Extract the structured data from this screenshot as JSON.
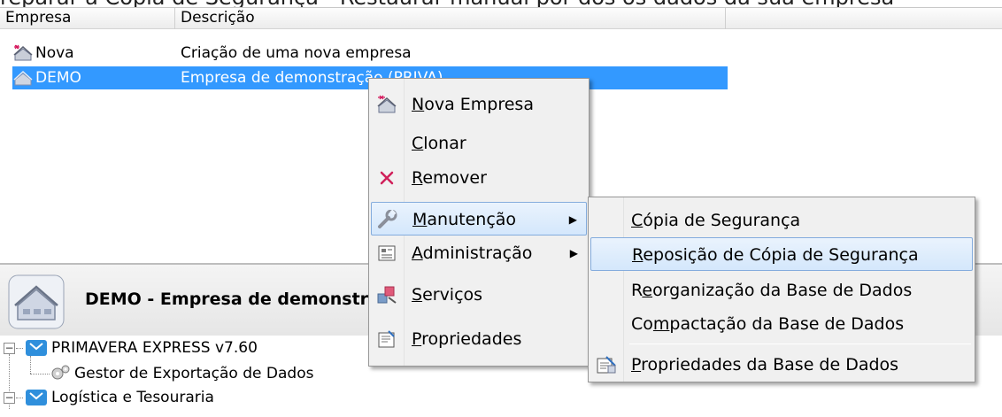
{
  "clipped_caption": "reparar a Cópia de Segurança - Restaurar manual por dos os dados da sua empresa",
  "list": {
    "columns": [
      "Empresa",
      "Descrição"
    ],
    "rows": [
      {
        "name": "Nova",
        "description": "Criação de uma nova empresa"
      },
      {
        "name": "DEMO",
        "description": "Empresa de demonstração (PRIVA)"
      }
    ]
  },
  "context_menu": {
    "items": [
      {
        "accel": "N",
        "rest": "ova Empresa",
        "icon": "new-company-icon"
      },
      {
        "accel": "C",
        "rest": "lonar",
        "icon": ""
      },
      {
        "accel": "R",
        "rest": "emover",
        "icon": "red-x-icon"
      },
      {
        "accel": "M",
        "rest": "anutenção",
        "icon": "wrench-icon",
        "submenu": true
      },
      {
        "accel": "A",
        "rest": "dministração",
        "icon": "admin-icon",
        "submenu": true
      },
      {
        "accel": "S",
        "rest": "erviços",
        "icon": "services-icon"
      },
      {
        "accel": "P",
        "rest": "ropriedades",
        "icon": "properties-icon"
      }
    ]
  },
  "submenu": {
    "items": [
      {
        "pre": "",
        "accel": "C",
        "rest": "ópia de Segurança"
      },
      {
        "pre": "",
        "accel": "R",
        "rest": "eposição de Cópia de Segurança"
      },
      {
        "pre": "R",
        "accel": "e",
        "rest": "organização da Base de Dados"
      },
      {
        "pre": "Co",
        "accel": "m",
        "rest": "pactação da Base de Dados"
      },
      {
        "pre": "",
        "accel": "P",
        "rest": "ropriedades da Base de Dados",
        "icon": "db-properties-icon"
      }
    ]
  },
  "company_panel": {
    "title": "DEMO - Empresa de demonstra"
  },
  "tree": {
    "root": "PRIMAVERA EXPRESS v7.60",
    "child1": "Gestor de Exportação de Dados",
    "child2": "Logística e Tesouraria"
  },
  "colors": {
    "selection": "#3399ff",
    "menu_bg": "#f0f0f0",
    "hover_border": "#84acdd"
  }
}
